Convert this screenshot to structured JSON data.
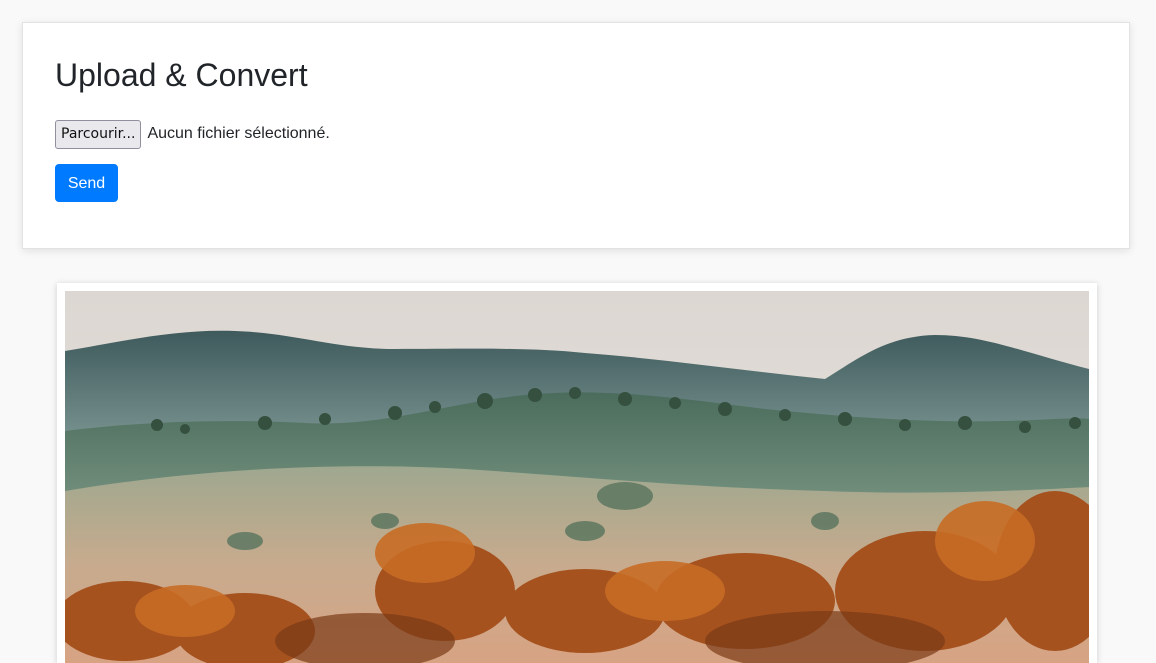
{
  "upload": {
    "title": "Upload & Convert",
    "browse_label": "Parcourir...",
    "file_status": "Aucun fichier sélectionné.",
    "send_label": "Send"
  },
  "image": {
    "subject": "landscape-photo"
  },
  "colors": {
    "page_bg": "#f9f9f9",
    "primary": "#007bff",
    "text": "#212529"
  }
}
